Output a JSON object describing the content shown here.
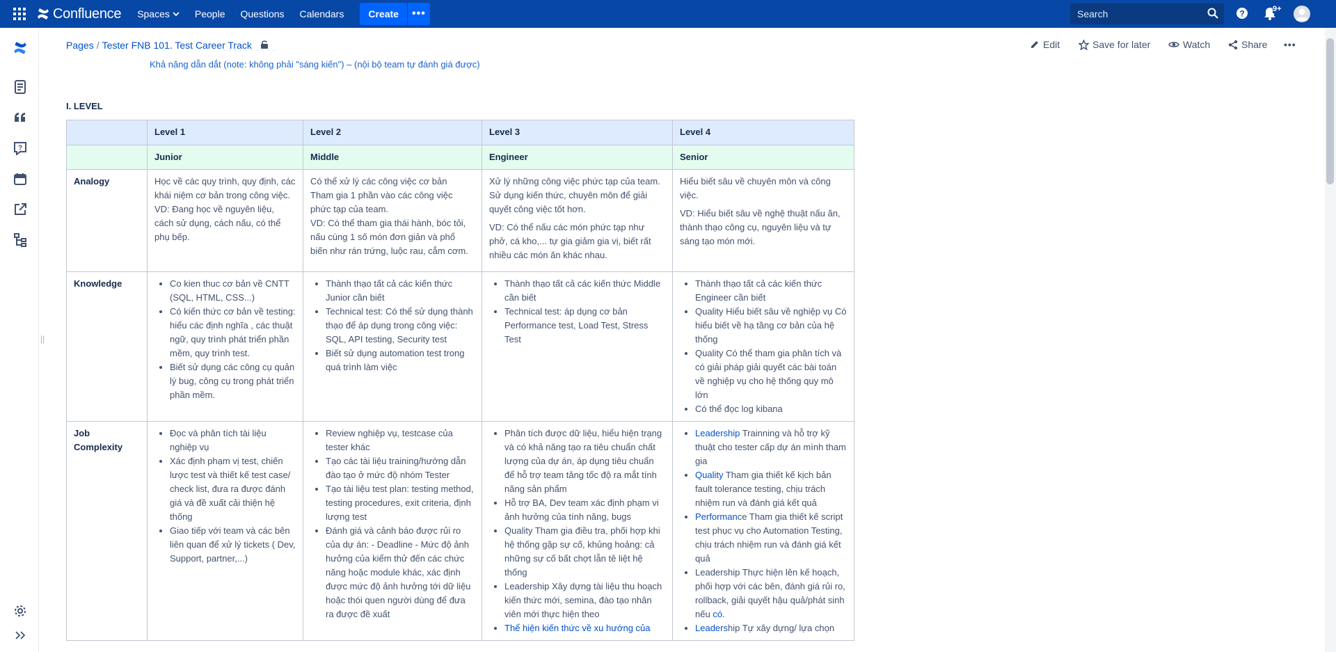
{
  "topnav": {
    "brand": "Confluence",
    "menu": [
      {
        "label": "Spaces",
        "has_caret": true
      },
      {
        "label": "People"
      },
      {
        "label": "Questions"
      },
      {
        "label": "Calendars"
      }
    ],
    "create_label": "Create",
    "more_label": "•••",
    "search_placeholder": "Search",
    "notif_count": "9+",
    "colors": {
      "nav_bg": "#0747a6",
      "create_bg": "#0065ff"
    }
  },
  "rail": {
    "icons": [
      "confluence-logo-icon",
      "pages-icon",
      "quote-icon",
      "question-icon",
      "calendar-icon",
      "external-link-icon",
      "tree-icon",
      "settings-icon",
      "expand-icon"
    ]
  },
  "breadcrumb": {
    "pages": "Pages",
    "sep": "/",
    "current": "Tester FNB 101. Test Career Track"
  },
  "actions": {
    "edit": "Edit",
    "save_for_later": "Save for later",
    "watch": "Watch",
    "share": "Share",
    "more": "•••"
  },
  "content": {
    "ghost_line": "Khả năng dẫn dắt (note: không phải \"sáng kiến\") – (nội bộ team tự đánh giá được)",
    "section_title": "I. LEVEL",
    "table": {
      "levels": [
        "Level 1",
        "Level 2",
        "Level 3",
        "Level 4"
      ],
      "titles": [
        "Junior",
        "Middle",
        "Engineer",
        "Senior"
      ],
      "rows": [
        {
          "label": "Analogy",
          "cells": [
            {
              "paras": [
                "Học về các quy trình, quy định, các khái niệm cơ bản trong công việc.\nVD: Đang học về nguyên liệu, cách sử dụng, cách nấu, có thể phụ bếp."
              ]
            },
            {
              "paras": [
                "Có thể xử lý các công việc cơ bản\nTham gia 1 phần vào các công việc phức tạp của team.\nVD: Có thể tham gia thái hành, bóc tỏi, nấu cùng 1 số món đơn giản và phổ biến như rán trứng, luộc rau, cắm cơm."
              ]
            },
            {
              "paras": [
                "Xử lý những công việc phức tạp của team.\nSử dụng kiến thức, chuyên môn để giải quyết công việc tốt hơn.",
                "VD: Có thể nấu các món phức tạp như phở, cá kho,... tự gia giảm gia vị, biết rất nhiều các món ăn khác nhau."
              ]
            },
            {
              "paras": [
                "Hiểu biết sâu về chuyên môn và công việc.",
                "VD: Hiểu biết sâu về nghệ thuật nấu ăn, thành thạo công cụ, nguyên liệu và tự sáng tạo món mới."
              ]
            }
          ]
        },
        {
          "label": "Knowledge",
          "cells": [
            {
              "items": [
                {
                  "text": "Co kien thuc cơ bản về CNTT (SQL, HTML, CSS...)"
                },
                {
                  "text": "Có kiến thức cơ bản về testing: hiểu các định nghĩa , các thuật ngữ, quy trình phát triển phần mềm, quy trình test."
                },
                {
                  "text": "Biết sử dụng các công cụ quản lý bug, công cụ trong phát triển phần mềm."
                }
              ]
            },
            {
              "items": [
                {
                  "text": "Thành thạo tất cả các kiến thức Junior cần biết"
                },
                {
                  "text": "Technical test: Có thể sử dụng thành thạo để áp dụng trong công việc: SQL, API testing, Security test"
                },
                {
                  "text": "Biết sử dụng automation test trong quá trình làm việc"
                }
              ]
            },
            {
              "items": [
                {
                  "text": "Thành thạo tất cả các kiến thức Middle cần biết"
                },
                {
                  "text": "Technical test: áp dụng cơ bản Performance test, Load Test, Stress Test"
                }
              ]
            },
            {
              "items": [
                {
                  "text": "Thành thạo tất cả các kiến thức Engineer cần biết"
                },
                {
                  "text": "Quality Hiểu biết sâu về nghiệp vụ Có hiểu biết về hạ tầng cơ bản của hệ thống"
                },
                {
                  "text": "Quality Có thể tham gia phân tích và có giải pháp giải quyết các bài toán về nghiệp vụ cho hệ thống quy mô lớn"
                },
                {
                  "text": "Có thể đọc log kibana"
                }
              ]
            }
          ]
        },
        {
          "label": "Job Complexity",
          "cells": [
            {
              "items": [
                {
                  "text": "Đọc và phân tích tài liệu nghiệp vụ"
                },
                {
                  "text": "Xác định phạm vị test, chiến lược test và thiết kế test case/ check list, đưa ra được đánh giá và đề xuất cải thiện hệ thống"
                },
                {
                  "text": "Giao tiếp với team và các bên liên quan để xử lý tickets ( Dev, Support, partner,...)"
                }
              ]
            },
            {
              "items": [
                {
                  "text": "Review nghiệp vụ, testcase của tester khác"
                },
                {
                  "text": "Tạo các tài liệu training/hướng dẫn đào tạo ở mức độ nhóm Tester"
                },
                {
                  "text": "Tạo tài liệu test plan: testing method, testing procedures, exit criteria, định lượng test"
                },
                {
                  "text": "Đánh giá và cảnh báo  được rủi ro của dự án: - Deadline - Mức độ ảnh hưởng của kiểm thử đến các chức năng hoặc module khác, xác định được mức độ ảnh hưởng tới dữ liệu hoặc thói quen người dùng để đưa ra được đề xuất"
                }
              ]
            },
            {
              "items": [
                {
                  "text": "Phân tích được dữ liệu, hiểu hiện trạng và có khả năng tạo ra tiêu chuẩn chất lượng của dự án, áp dụng tiêu chuẩn để hỗ trợ team tăng tốc độ ra mắt tính năng sản phẩm"
                },
                {
                  "text": "Hỗ trợ BA, Dev team xác định phạm vi ảnh hưởng của tính năng, bugs"
                },
                {
                  "text": "Quality Tham gia điều tra, phối hợp khi hệ thống gặp sự cố, khủng hoảng: cả những sự cố bất chợt lẫn tê liệt hệ thống"
                },
                {
                  "text": "Leadership Xây dựng tài liệu thu hoạch kiến thức mới, semina, đào tạo nhân viên mới thực hiện theo"
                },
                {
                  "kw": "Thể hiện kiến thức về xu hướng của",
                  "text": ""
                }
              ]
            },
            {
              "items": [
                {
                  "kw": "Leadership",
                  "text": " Trainning và hỗ trợ kỹ thuật cho tester cấp dự án mình tham gia"
                },
                {
                  "kw": "Quality",
                  "text": " Tham gia thiết kế kịch bản fault tolerance testing, chịu trách nhiệm run và đánh giá kết quả"
                },
                {
                  "kw": "Performan",
                  "text": "ce Tham gia thiết kế script test phục vụ cho Automation Testing, chịu trách nhiệm run và đánh giá kết quả"
                },
                {
                  "text": "Leadership Thực hiện lên kế hoạch, phối hợp với các bên, đánh giá rủi ro, rollback, giải quyết hậu quả/phát sinh nếu ",
                  "kw_tail": "có."
                },
                {
                  "kw": "Leaders",
                  "text": "hip Tự xây dựng/ lựa chọn"
                }
              ]
            }
          ]
        }
      ]
    }
  }
}
